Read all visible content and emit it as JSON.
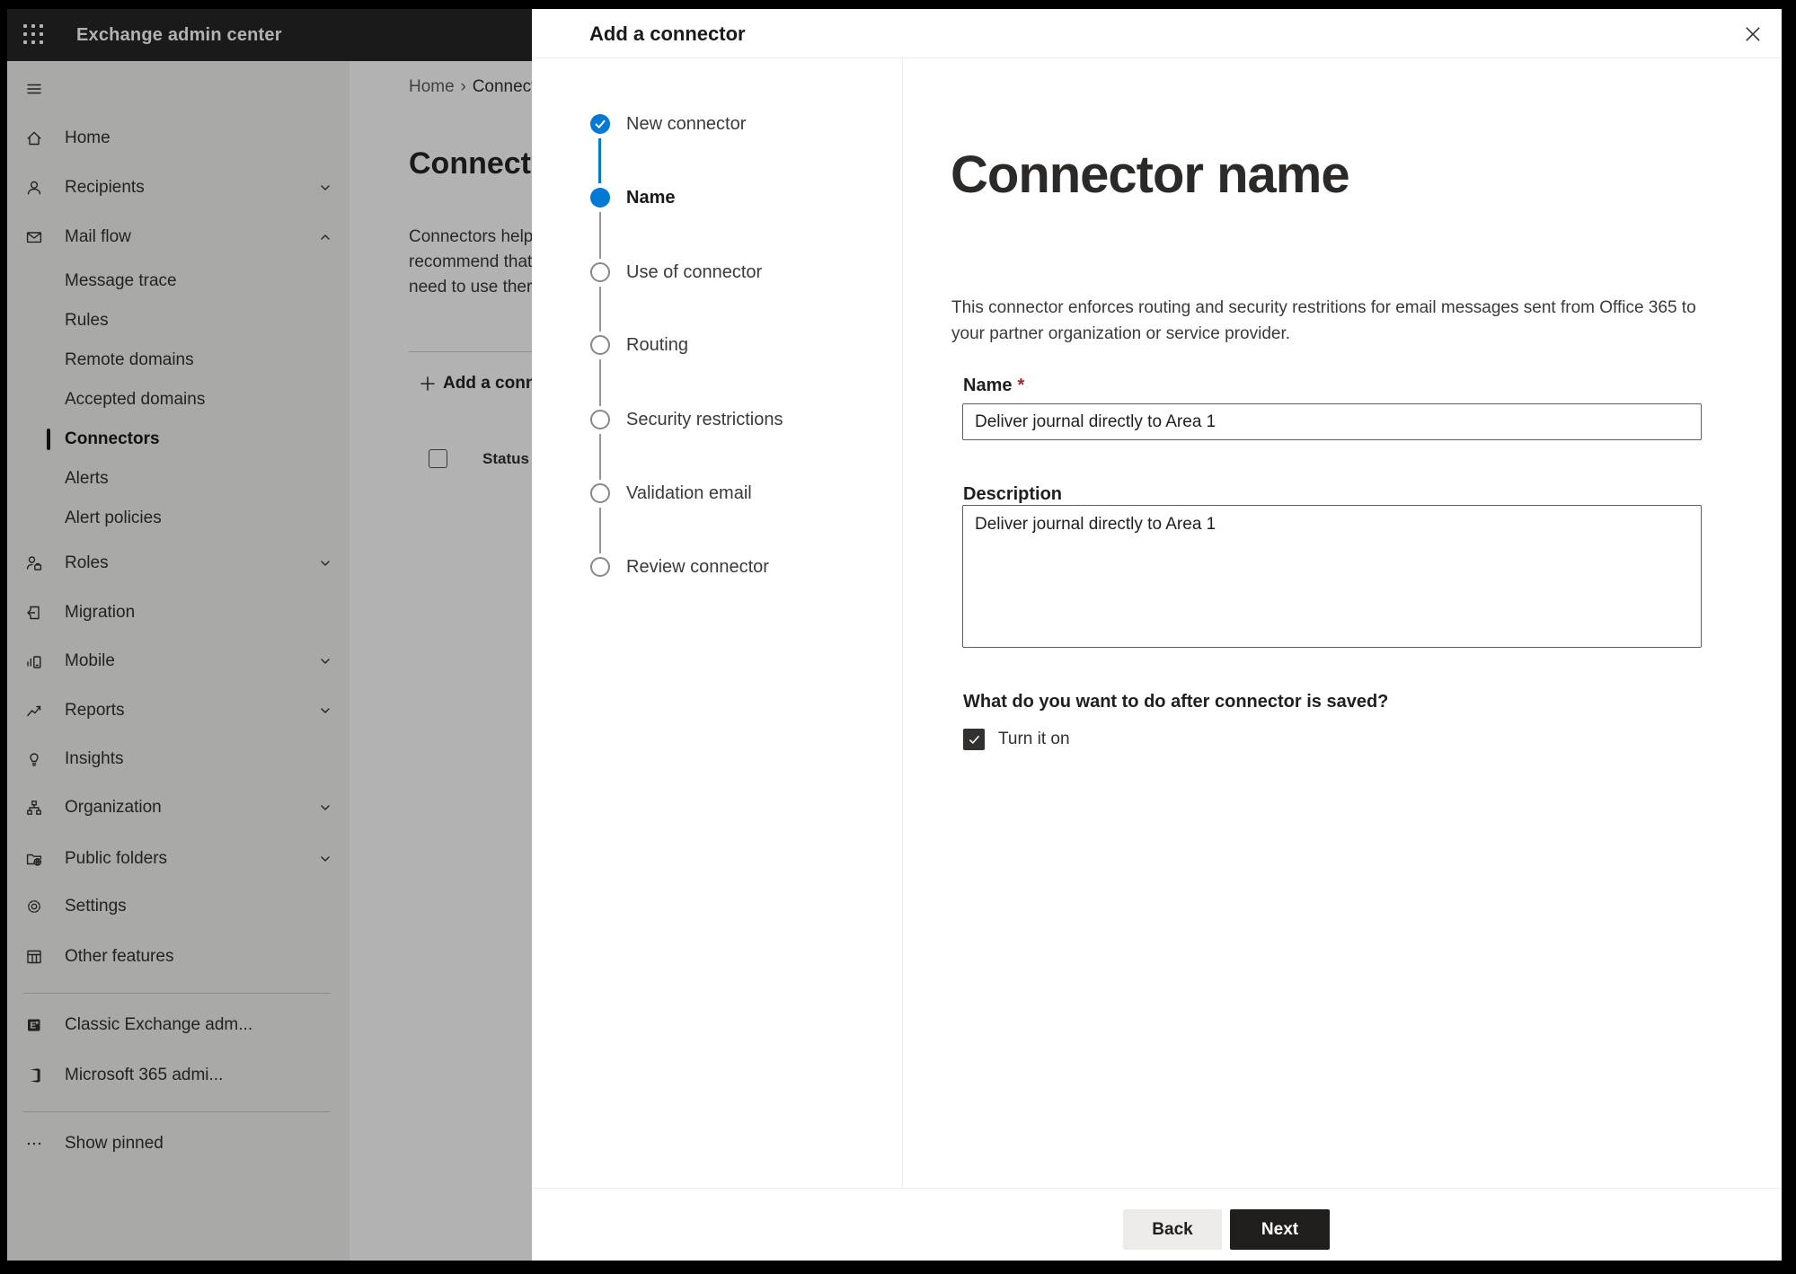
{
  "colors": {
    "accent_blue": "#0078d4",
    "topbar_bg": "#262626",
    "required_red": "#a4262c",
    "next_button_bg": "#1f1e1d",
    "back_button_bg": "#edebe9",
    "sidebar_bg": "#f3f2f1"
  },
  "topbar": {
    "title": "Exchange admin center"
  },
  "sidebar": {
    "items": [
      {
        "label": "Home"
      },
      {
        "label": "Recipients"
      },
      {
        "label": "Mail flow"
      },
      {
        "label": "Message trace"
      },
      {
        "label": "Rules"
      },
      {
        "label": "Remote domains"
      },
      {
        "label": "Accepted domains"
      },
      {
        "label": "Connectors",
        "selected": true
      },
      {
        "label": "Alerts"
      },
      {
        "label": "Alert policies"
      },
      {
        "label": "Roles"
      },
      {
        "label": "Migration"
      },
      {
        "label": "Mobile"
      },
      {
        "label": "Reports"
      },
      {
        "label": "Insights"
      },
      {
        "label": "Organization"
      },
      {
        "label": "Public folders"
      },
      {
        "label": "Settings"
      },
      {
        "label": "Other features"
      },
      {
        "label": "Classic Exchange adm..."
      },
      {
        "label": "Microsoft 365 admi..."
      },
      {
        "label": "Show pinned"
      }
    ]
  },
  "page": {
    "breadcrumb": {
      "home": "Home",
      "current": "Connectors"
    },
    "title": "Connectors",
    "intro_lines": [
      "Connectors help",
      "recommend that",
      "need to use ther"
    ],
    "add_button": "Add a connector",
    "table_header": {
      "column": "Status"
    }
  },
  "dialog": {
    "title": "Add a connector",
    "steps": [
      {
        "label": "New connector",
        "state": "completed"
      },
      {
        "label": "Name",
        "state": "current"
      },
      {
        "label": "Use of connector",
        "state": "upcoming"
      },
      {
        "label": "Routing",
        "state": "upcoming"
      },
      {
        "label": "Security restrictions",
        "state": "upcoming"
      },
      {
        "label": "Validation email",
        "state": "upcoming"
      },
      {
        "label": "Review connector",
        "state": "upcoming"
      }
    ],
    "content": {
      "heading": "Connector name",
      "description": "This connector enforces routing and security restritions for email messages sent from Office 365 to your partner organization or service provider.",
      "name_label": "Name",
      "required_mark": "*",
      "name_value": "Deliver journal directly to Area 1",
      "description_label": "Description",
      "description_value": "Deliver journal directly to Area 1",
      "after_save_question": "What do you want to do after connector is saved?",
      "turn_on_label": "Turn it on",
      "turn_on_checked": true
    },
    "footer": {
      "back": "Back",
      "next": "Next"
    }
  }
}
